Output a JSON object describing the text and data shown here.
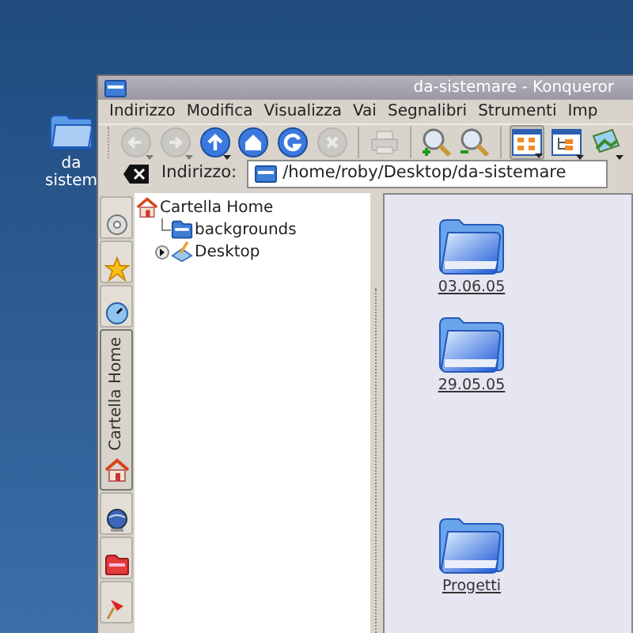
{
  "desktop": {
    "icons": [
      {
        "label": "da sistem"
      }
    ]
  },
  "window": {
    "title": "da-sistemare - Konqueror"
  },
  "menu": [
    "Indirizzo",
    "Modifica",
    "Visualizza",
    "Vai",
    "Segnalibri",
    "Strumenti",
    "Imp"
  ],
  "toolbar": [
    {
      "kind": "back",
      "disabled": true
    },
    {
      "kind": "forward",
      "disabled": true
    },
    {
      "kind": "up",
      "disabled": false
    },
    {
      "kind": "home",
      "disabled": false
    },
    {
      "kind": "reload",
      "disabled": false
    },
    {
      "kind": "stop",
      "disabled": true
    },
    {
      "kind": "sep"
    },
    {
      "kind": "print",
      "disabled": true
    },
    {
      "kind": "sep"
    },
    {
      "kind": "zoom-in",
      "disabled": false
    },
    {
      "kind": "zoom-out",
      "disabled": false
    },
    {
      "kind": "sep"
    },
    {
      "kind": "icon-view",
      "disabled": false,
      "selected": true
    },
    {
      "kind": "tree-view",
      "disabled": false,
      "selected": false
    },
    {
      "kind": "image",
      "disabled": false,
      "selected": false
    }
  ],
  "location": {
    "label": "Indirizzo:",
    "value": "/home/roby/Desktop/da-sistemare"
  },
  "sidebar_tabs": [
    {
      "kind": "disc",
      "selected": false
    },
    {
      "kind": "star",
      "selected": false
    },
    {
      "kind": "clock",
      "selected": false
    },
    {
      "kind": "home",
      "label": "Cartella Home",
      "selected": true
    },
    {
      "kind": "globe",
      "selected": false
    },
    {
      "kind": "folder",
      "selected": false
    },
    {
      "kind": "pin",
      "selected": false
    }
  ],
  "tree": [
    {
      "label": "Cartella Home",
      "kind": "home",
      "expanded": true,
      "children": [
        {
          "label": "backgrounds",
          "kind": "folder"
        },
        {
          "label": "Desktop",
          "kind": "desktop",
          "expanded": false
        }
      ]
    }
  ],
  "files": [
    {
      "name": "03.06.05"
    },
    {
      "name": "29.05.05"
    },
    {
      "name": "Progetti"
    }
  ]
}
